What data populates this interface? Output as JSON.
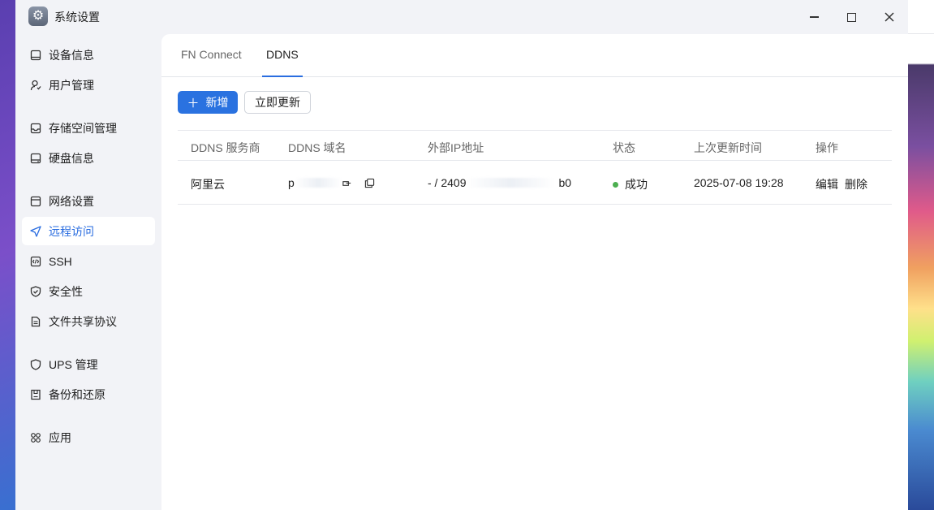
{
  "window": {
    "title": "系统设置"
  },
  "sidebar": {
    "items": [
      {
        "label": "设备信息",
        "icon": "device-icon"
      },
      {
        "label": "用户管理",
        "icon": "user-icon"
      },
      {
        "label": "存储空间管理",
        "icon": "storage-icon"
      },
      {
        "label": "硬盘信息",
        "icon": "disk-icon"
      },
      {
        "label": "网络设置",
        "icon": "network-icon"
      },
      {
        "label": "远程访问",
        "icon": "send-icon",
        "active": true
      },
      {
        "label": "SSH",
        "icon": "code-icon"
      },
      {
        "label": "安全性",
        "icon": "shield-check-icon"
      },
      {
        "label": "文件共享协议",
        "icon": "document-icon"
      },
      {
        "label": "UPS 管理",
        "icon": "shield-icon"
      },
      {
        "label": "备份和还原",
        "icon": "backup-icon"
      },
      {
        "label": "应用",
        "icon": "apps-icon"
      }
    ]
  },
  "tabs": [
    {
      "label": "FN Connect"
    },
    {
      "label": "DDNS",
      "active": true
    }
  ],
  "toolbar": {
    "add_label": "新增",
    "update_label": "立即更新"
  },
  "table": {
    "headers": [
      "DDNS 服务商",
      "DDNS 域名",
      "外部IP地址",
      "状态",
      "上次更新时间",
      "操作"
    ],
    "rows": [
      {
        "provider": "阿里云",
        "domain_prefix": "p",
        "ip_prefix": "- / 2409",
        "ip_suffix": "b0",
        "status": "成功",
        "updated": "2025-07-08 19:28",
        "edit": "编辑",
        "delete": "删除"
      }
    ]
  },
  "colors": {
    "accent": "#2a72e0",
    "success": "#4caf50"
  }
}
